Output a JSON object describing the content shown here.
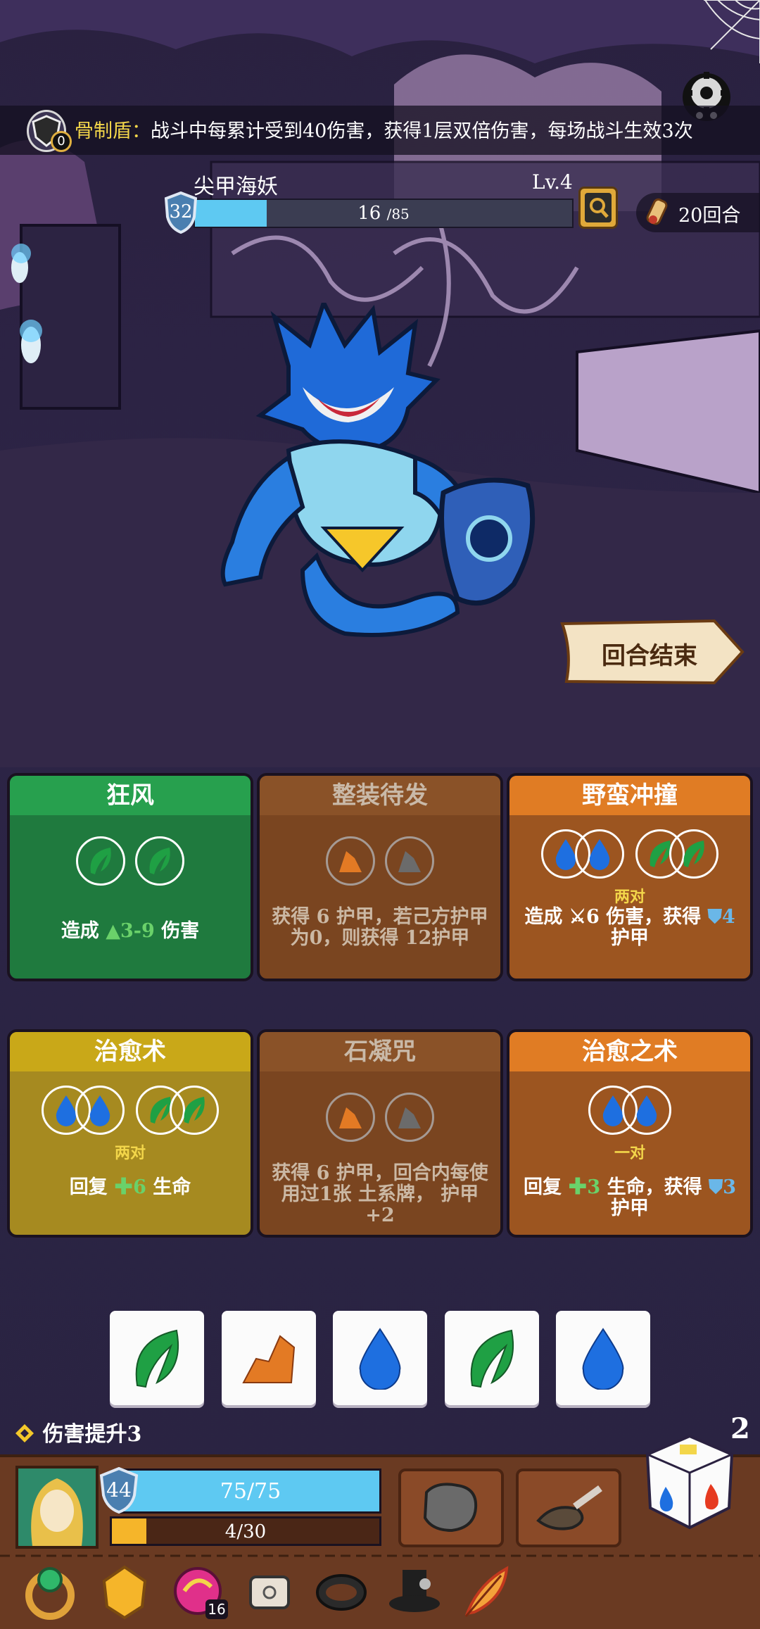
{
  "relic": {
    "count": "0",
    "name": "骨制盾：",
    "description": "战斗中每累计受到40伤害，获得1层双倍伤害，每场战斗生效3次"
  },
  "enemy": {
    "name": "尖甲海妖",
    "level": "Lv.4",
    "armor": "32",
    "hp_current": "16",
    "hp_max": "/85",
    "hp_fraction": 0.19
  },
  "rounds": "20回合",
  "end_turn": "回合结束",
  "cards": [
    {
      "title": "狂风",
      "desc_a": "造成",
      "value": "3-9",
      "desc_b": "伤害"
    },
    {
      "title": "整装待发",
      "desc": "获得 6 护甲，若己方护甲为0，则获得 12护甲"
    },
    {
      "title": "野蛮冲撞",
      "pair": "两对",
      "desc_a": "造成",
      "value": "6",
      "desc_b": "伤害，获得",
      "armor": "4",
      "desc_c": "护甲"
    },
    {
      "title": "治愈术",
      "pair": "两对",
      "desc_a": "回复",
      "value": "6",
      "desc_b": "生命"
    },
    {
      "title": "石凝咒",
      "desc": "获得 6 护甲，回合内每使用过1张 土系牌， 护甲+2"
    },
    {
      "title": "治愈之术",
      "pair": "一对",
      "desc_a": "回复",
      "value": "3",
      "desc_b": "生命，获得",
      "armor": "3",
      "desc_c": "护甲"
    }
  ],
  "dice": [
    "leaf",
    "rock",
    "water",
    "leaf",
    "water"
  ],
  "buff": "伤害提升3",
  "reroll_count": "2",
  "player": {
    "armor": "44",
    "hp": "75/75",
    "hp_fraction": 1.0,
    "xp": "4/30",
    "xp_fraction": 0.13
  },
  "relics": {
    "stack_count": "16"
  },
  "colors": {
    "leaf": "#1fa044",
    "water": "#1e6fe0",
    "rock": "#e37a24",
    "highlight": "#f3d64a"
  }
}
